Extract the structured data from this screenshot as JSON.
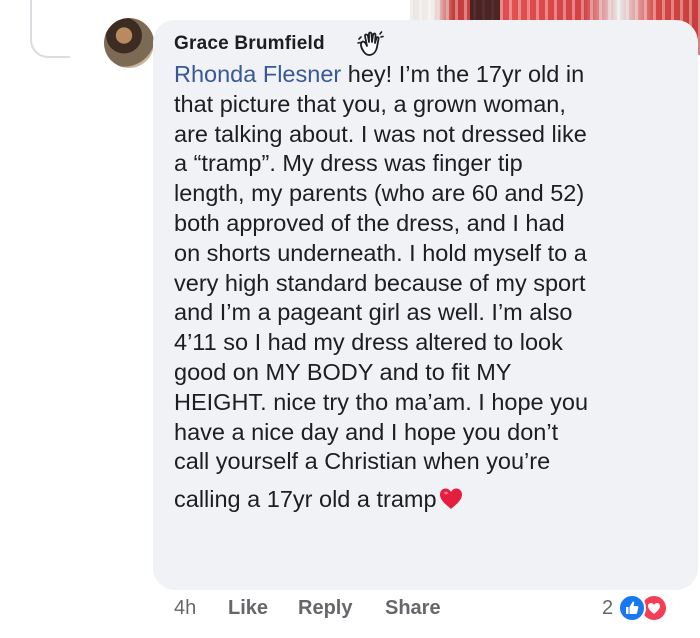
{
  "comment": {
    "author": "Grace Brumfield",
    "mention": "Rhonda Flesner",
    "lines": [
      " hey! I’m the 17yr old in",
      "that picture that you, a grown woman,",
      "are talking about. I was not dressed like",
      "a “tramp”. My dress was finger tip",
      "length, my parents (who are 60 and 52)",
      "both approved of the dress, and I had",
      "on shorts underneath. I hold myself to a",
      "very high standard because of my sport",
      "and I’m a pageant girl as well. I’m also",
      "4’11 so I had my dress altered to look",
      "good on MY BODY and to fit MY",
      "HEIGHT. nice try tho ma’am. I hope you",
      "have a nice day and I hope you don’t",
      "call yourself a Christian when you’re",
      "calling a 17yr old a tramp"
    ]
  },
  "footer": {
    "timestamp": "4h",
    "like": "Like",
    "reply": "Reply",
    "share": "Share",
    "reaction_count": "2"
  },
  "icons": {
    "author_badge": "wave-hand-icon",
    "inline_emoji": "red-heart-icon",
    "reactions": [
      "like-reaction-icon",
      "love-reaction-icon"
    ]
  },
  "colors": {
    "bubble": "#f0f2f5",
    "mention": "#385898",
    "text": "#1c1e21",
    "meta": "#65676b",
    "like": "#1877f2",
    "love": "#f33e58"
  }
}
